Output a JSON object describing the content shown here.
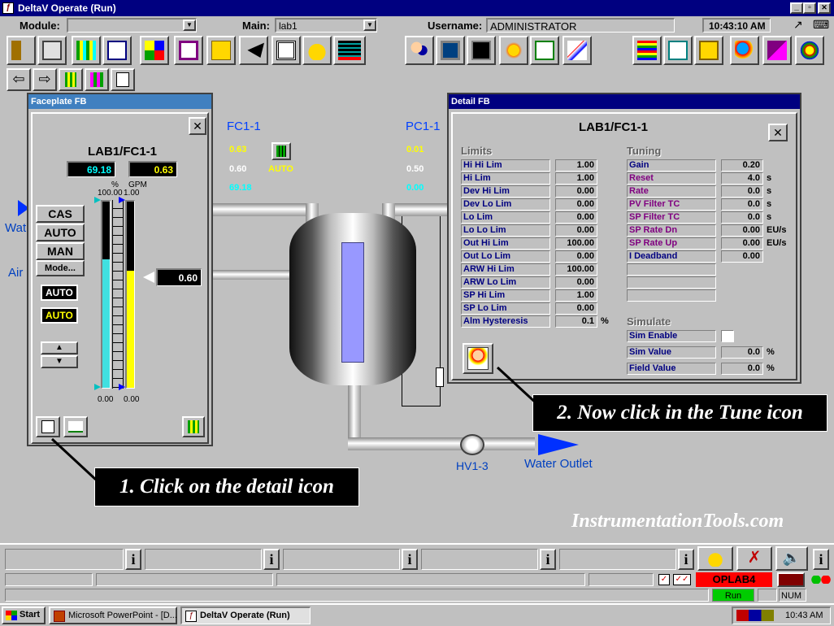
{
  "window": {
    "title": "DeltaV Operate (Run)",
    "min": "_",
    "max": "▫",
    "close": "✕"
  },
  "header": {
    "module_label": "Module:",
    "module_value": "",
    "main_label": "Main:",
    "main_value": "lab1",
    "username_label": "Username:",
    "username_value": "ADMINISTRATOR",
    "time": "10:43:10 AM"
  },
  "faceplate": {
    "title": "Faceplate FB",
    "close": "✕",
    "tag": "LAB1/FC1-1",
    "pv": "69.18",
    "sp": "0.63",
    "pv_unit": "%",
    "sp_unit": "GPM",
    "pv_scale_top": "100.00",
    "sp_scale_top": "1.00",
    "pv_scale_bottom": "0.00",
    "sp_scale_bottom": "0.00",
    "pv_level": 0.69,
    "sp_level": 0.63,
    "output": "0.60",
    "modes": [
      "CAS",
      "AUTO",
      "MAN",
      "Mode..."
    ],
    "actual_mode": "AUTO",
    "target_mode": "AUTO"
  },
  "process": {
    "fc_tag": "FC1-1",
    "fc_sp": "0.63",
    "fc_out": "0.60",
    "fc_pv": "69.18",
    "fc_mode": "AUTO",
    "pc_tag": "PC1-1",
    "pc_sp": "0.01",
    "pc_out": "0.50",
    "pc_pv": "0.00",
    "water_in": "Wat",
    "air_in": "Air",
    "valve_tag": "HV1-3",
    "outlet": "Water Outlet"
  },
  "detail": {
    "title": "Detail FB",
    "close": "✕",
    "tag": "LAB1/FC1-1",
    "limits_header": "Limits",
    "limits": [
      {
        "label": "Hi Hi Lim",
        "value": "1.00"
      },
      {
        "label": "Hi Lim",
        "value": "1.00"
      },
      {
        "label": "Dev Hi Lim",
        "value": "0.00"
      },
      {
        "label": "Dev Lo Lim",
        "value": "0.00"
      },
      {
        "label": "Lo Lim",
        "value": "0.00"
      },
      {
        "label": "Lo Lo Lim",
        "value": "0.00"
      },
      {
        "label": "Out Hi Lim",
        "value": "100.00"
      },
      {
        "label": "Out Lo Lim",
        "value": "0.00"
      },
      {
        "label": "ARW Hi Lim",
        "value": "100.00"
      },
      {
        "label": "ARW Lo Lim",
        "value": "0.00"
      },
      {
        "label": "SP Hi Lim",
        "value": "1.00"
      },
      {
        "label": "SP Lo Lim",
        "value": "0.00"
      },
      {
        "label": "Alm Hysteresis",
        "value": "0.1",
        "unit": "%"
      }
    ],
    "tuning_header": "Tuning",
    "tuning": [
      {
        "label": "Gain",
        "value": "0.20",
        "unit": ""
      },
      {
        "label": "Reset",
        "value": "4.0",
        "unit": "s"
      },
      {
        "label": "Rate",
        "value": "0.0",
        "unit": "s"
      },
      {
        "label": "PV Filter TC",
        "value": "0.0",
        "unit": "s"
      },
      {
        "label": "SP Filter TC",
        "value": "0.0",
        "unit": "s"
      },
      {
        "label": "SP Rate Dn",
        "value": "0.00",
        "unit": "EU/s"
      },
      {
        "label": "SP Rate Up",
        "value": "0.00",
        "unit": "EU/s"
      },
      {
        "label": "I Deadband",
        "value": "0.00",
        "unit": ""
      }
    ],
    "simulate_header": "Simulate",
    "simulate": [
      {
        "label": "Sim Enable",
        "value": ""
      },
      {
        "label": "Sim Value",
        "value": "0.0",
        "unit": "%"
      },
      {
        "label": "Field Value",
        "value": "0.0",
        "unit": "%"
      }
    ]
  },
  "callouts": {
    "step1": "1. Click on the detail icon",
    "step2": "2. Now click in the Tune icon"
  },
  "watermark": "InstrumentationTools.com",
  "statusbar": {
    "alarm_node": "OPLAB4",
    "run": "Run",
    "num": "NUM"
  },
  "taskbar": {
    "start": "Start",
    "task1": "Microsoft PowerPoint - [D...",
    "task2": "DeltaV Operate (Run)",
    "clock": "10:43 AM"
  },
  "colors": {
    "title_bar": "#000080",
    "pv": "#00ffff",
    "sp": "#ffff00",
    "alarm": "#ff0000",
    "run": "#00cc00"
  }
}
